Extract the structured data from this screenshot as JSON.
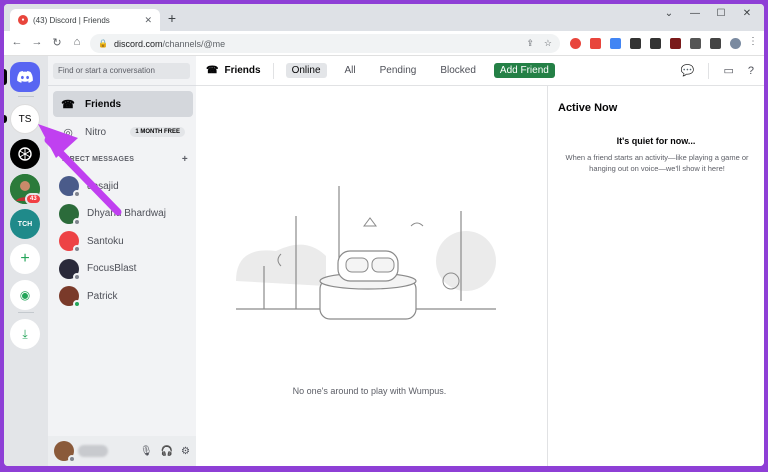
{
  "browser": {
    "tab_title": "(43) Discord | Friends",
    "url_domain": "discord.com",
    "url_path": "/channels/@me"
  },
  "guilds": {
    "ts_label": "TS",
    "tch_label": "TCH",
    "badge_count": "43"
  },
  "dm_sidebar": {
    "search_placeholder": "Find or start a conversation",
    "nav": [
      {
        "label": "Friends",
        "icon": "friends-icon"
      },
      {
        "label": "Nitro",
        "icon": "nitro-icon",
        "badge": "1 MONTH FREE"
      }
    ],
    "header": "DIRECT MESSAGES",
    "items": [
      {
        "name": "desajid",
        "avatar_color": "#4a5b8a",
        "online": false
      },
      {
        "name": "Dhyanu Bhardwaj",
        "avatar_color": "#2b6b3a",
        "online": false
      },
      {
        "name": "Santoku",
        "avatar_color": "#ed4245",
        "online": false
      },
      {
        "name": "FocusBlast",
        "avatar_color": "#2a2a3a",
        "online": false
      },
      {
        "name": "Patrick",
        "avatar_color": "#7a3a2a",
        "online": true
      }
    ]
  },
  "header": {
    "title": "Friends",
    "tabs": [
      "Online",
      "All",
      "Pending",
      "Blocked"
    ],
    "selected_tab": "Online",
    "add_friend": "Add Friend"
  },
  "main": {
    "empty_text": "No one's around to play with Wumpus."
  },
  "active_now": {
    "title": "Active Now",
    "quiet": "It's quiet for now...",
    "desc": "When a friend starts an activity—like playing a game or hanging out on voice—we'll show it here!"
  },
  "colors": {
    "blurple": "#5865f2",
    "green": "#248046",
    "arrow": "#c040f0",
    "background": "#8e3fd6"
  }
}
